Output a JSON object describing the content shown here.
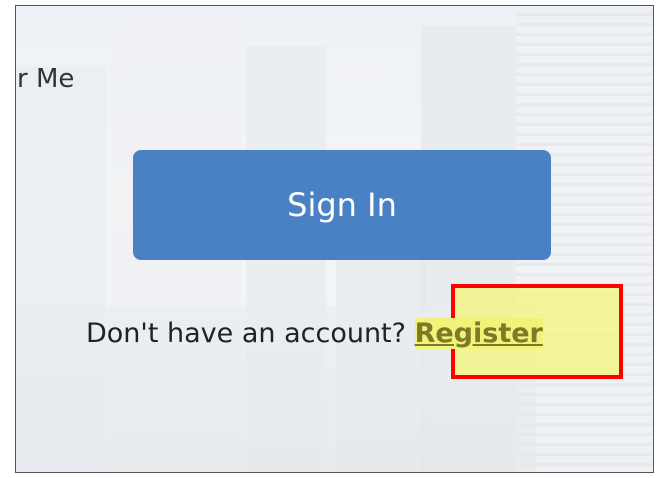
{
  "login": {
    "remember_label": "r Me",
    "signin_label": "Sign In",
    "no_account_text": "Don't have an account? ",
    "register_label": "Register"
  },
  "colors": {
    "primary_button": "#4a80c4",
    "highlight_border": "#ff0000",
    "highlight_fill": "#f3f578",
    "link_text": "#7c7a27"
  }
}
